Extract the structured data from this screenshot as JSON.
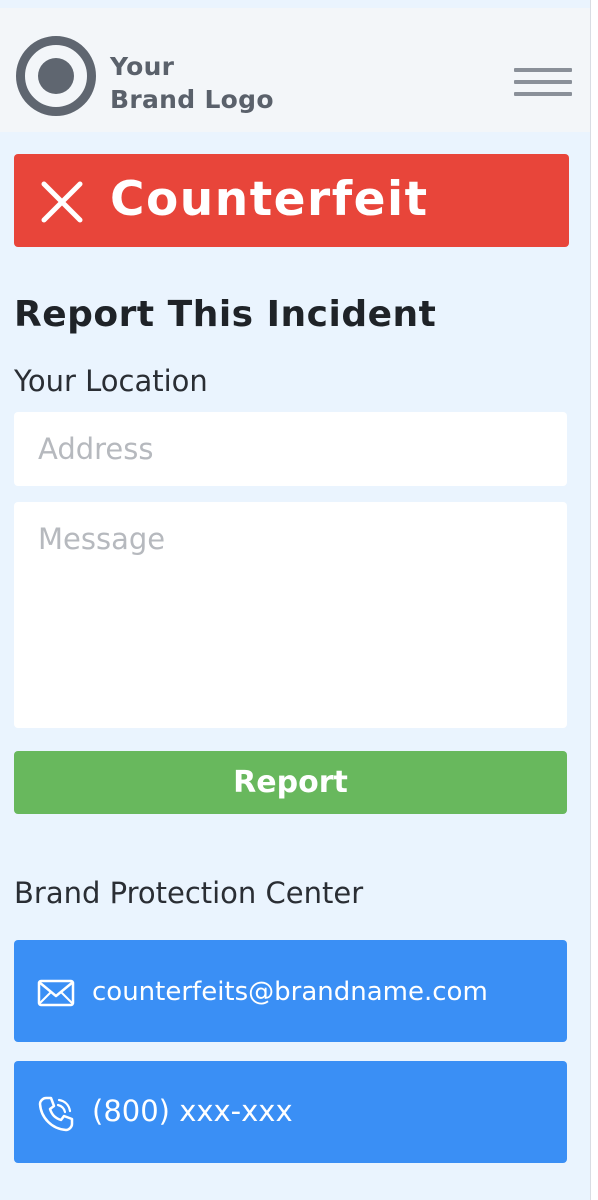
{
  "header": {
    "logo_line1": "Your",
    "logo_line2": "Brand Logo"
  },
  "banner": {
    "status": "Counterfeit",
    "icon": "x-icon",
    "color": "#e8453a"
  },
  "report": {
    "title": "Report This Incident",
    "location_label": "Your Location",
    "address_placeholder": "Address",
    "message_placeholder": "Message",
    "button_label": "Report",
    "button_color": "#68b85d"
  },
  "protection": {
    "title": "Brand Protection Center",
    "email": "counterfeits@brandname.com",
    "phone": "(800) xxx-xxx",
    "card_color": "#3a8ff5"
  }
}
